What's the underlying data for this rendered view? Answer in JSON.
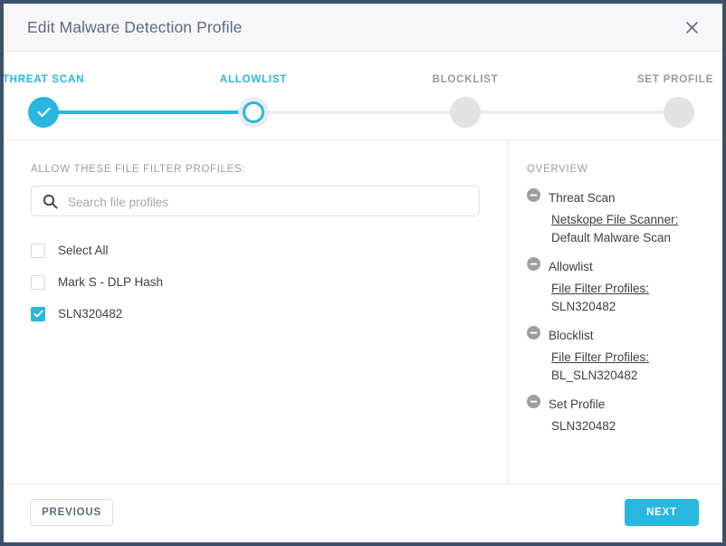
{
  "dialog": {
    "title": "Edit Malware Detection Profile",
    "close_icon": "close-icon"
  },
  "stepper": {
    "steps": [
      {
        "label": "THREAT SCAN",
        "state": "done"
      },
      {
        "label": "ALLOWLIST",
        "state": "current"
      },
      {
        "label": "BLOCKLIST",
        "state": "todo"
      },
      {
        "label": "SET PROFILE",
        "state": "todo"
      }
    ]
  },
  "left_pane": {
    "caption": "ALLOW THESE FILE FILTER PROFILES:",
    "search": {
      "placeholder": "Search file profiles",
      "value": "",
      "icon": "search-icon"
    },
    "options": [
      {
        "label": "Select All",
        "checked": false
      },
      {
        "label": "Mark S - DLP Hash",
        "checked": false
      },
      {
        "label": "SLN320482",
        "checked": true
      }
    ]
  },
  "overview": {
    "caption": "OVERVIEW",
    "groups": [
      {
        "title": "Threat Scan",
        "key": "Netskope File Scanner:",
        "value": "Default Malware Scan"
      },
      {
        "title": "Allowlist",
        "key": "File Filter Profiles:",
        "value": "SLN320482"
      },
      {
        "title": "Blocklist",
        "key": "File Filter Profiles:",
        "value": "BL_SLN320482"
      },
      {
        "title": "Set Profile",
        "key": "",
        "value": "SLN320482"
      }
    ]
  },
  "footer": {
    "previous_label": "PREVIOUS",
    "next_label": "NEXT"
  },
  "colors": {
    "accent": "#29b6e0",
    "header_bg": "#f7f7f9",
    "title_text": "#5c6b82",
    "muted_text": "#9a9a9a",
    "page_bg": "#3d506b",
    "step_inactive": "#e2e2e2"
  }
}
